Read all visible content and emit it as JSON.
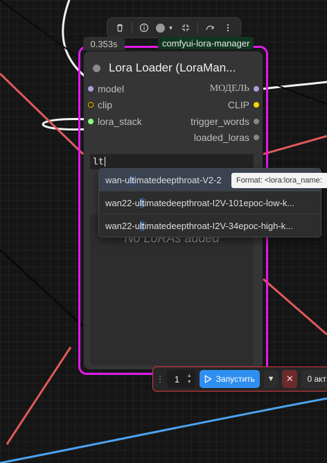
{
  "toolbar": {
    "icons": [
      "trash-icon",
      "info-icon",
      "color-circle-icon",
      "chevron-down-icon",
      "collapse-icon",
      "bypass-icon",
      "more-icon"
    ]
  },
  "node": {
    "timing": "0.353s",
    "badge": "comfyui-lora-manager",
    "title": "Lora Loader (LoraMan...",
    "inputs": [
      {
        "label": "model",
        "color": "#b39ddb"
      },
      {
        "label": "clip",
        "color": "#e6c000"
      },
      {
        "label": "lora_stack",
        "color": "#8aff80"
      }
    ],
    "outputs": [
      {
        "label": "МОДЕЛЬ",
        "color": "#b39ddb"
      },
      {
        "label": "CLIP",
        "color": "#ffd500"
      },
      {
        "label": "trigger_words",
        "color": "#888888"
      },
      {
        "label": "loaded_loras",
        "color": "#888888"
      }
    ],
    "search_value": "lt",
    "empty_text": "No LoRAs added"
  },
  "autocomplete": {
    "items": [
      {
        "pre": "wan-u",
        "match": "lt",
        "post": "imatedeepthroat-V2-2"
      },
      {
        "pre": "wan22-u",
        "match": "lt",
        "post": "imatedeepthroat-I2V-101epoc-low-k..."
      },
      {
        "pre": "wan22-u",
        "match": "lt",
        "post": "imatedeepthroat-I2V-34epoc-high-k..."
      }
    ]
  },
  "tooltip": "Format: <lora:lora_name:",
  "runbar": {
    "batch_count": "1",
    "run_label": "Запустить",
    "active_label": "0 акт"
  },
  "colors": {
    "accent": "#e11be8",
    "run": "#2f8ff0",
    "stop": "#6b2b2b"
  }
}
